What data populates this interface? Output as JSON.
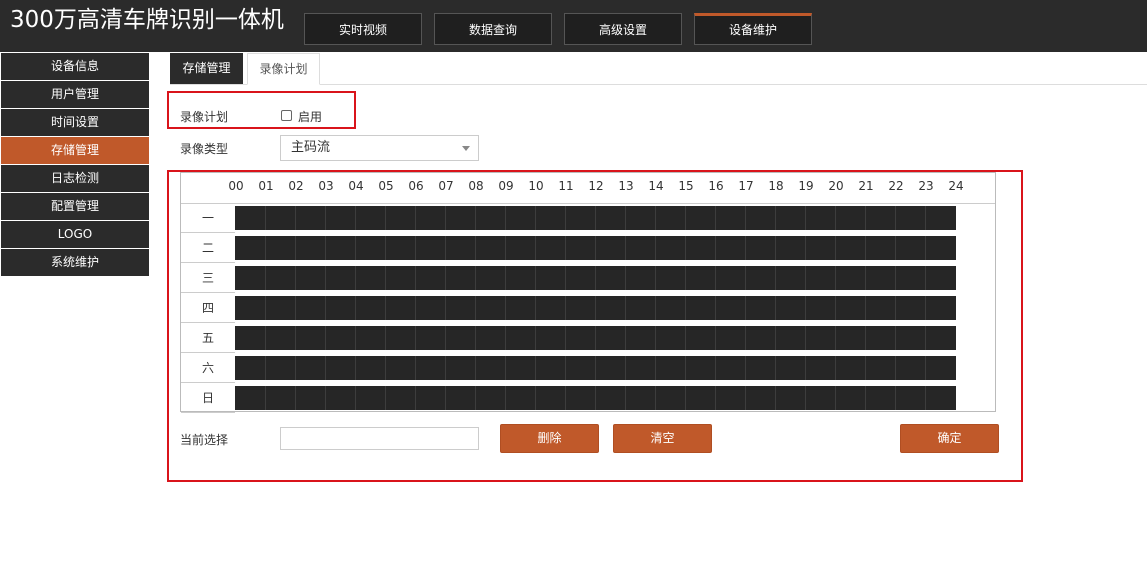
{
  "header": {
    "title": "300万高清车牌识别一体机",
    "tabs": [
      {
        "label": "实时视频"
      },
      {
        "label": "数据查询"
      },
      {
        "label": "高级设置"
      },
      {
        "label": "设备维护",
        "active": true
      }
    ]
  },
  "sidebar": {
    "items": [
      {
        "label": "设备信息"
      },
      {
        "label": "用户管理"
      },
      {
        "label": "时间设置"
      },
      {
        "label": "存储管理",
        "active": true
      },
      {
        "label": "日志检测"
      },
      {
        "label": "配置管理"
      },
      {
        "label": "LOGO"
      },
      {
        "label": "系统维护"
      }
    ]
  },
  "subtabs": [
    {
      "label": "存储管理"
    },
    {
      "label": "录像计划",
      "active": true
    }
  ],
  "form": {
    "plan_label": "录像计划",
    "enable_label": "启用",
    "enable_checked": false,
    "type_label": "录像类型",
    "type_value": "主码流"
  },
  "schedule": {
    "hours": [
      "00",
      "01",
      "02",
      "03",
      "04",
      "05",
      "06",
      "07",
      "08",
      "09",
      "10",
      "11",
      "12",
      "13",
      "14",
      "15",
      "16",
      "17",
      "18",
      "19",
      "20",
      "21",
      "22",
      "23",
      "24"
    ],
    "days": [
      "一",
      "二",
      "三",
      "四",
      "五",
      "六",
      "日"
    ]
  },
  "footer": {
    "current_label": "当前选择",
    "current_value": "",
    "delete_label": "删除",
    "clear_label": "清空",
    "confirm_label": "确定"
  },
  "colors": {
    "accent": "#c0592a",
    "dark": "#2b2b2b",
    "highlight_border": "#d9141b"
  }
}
